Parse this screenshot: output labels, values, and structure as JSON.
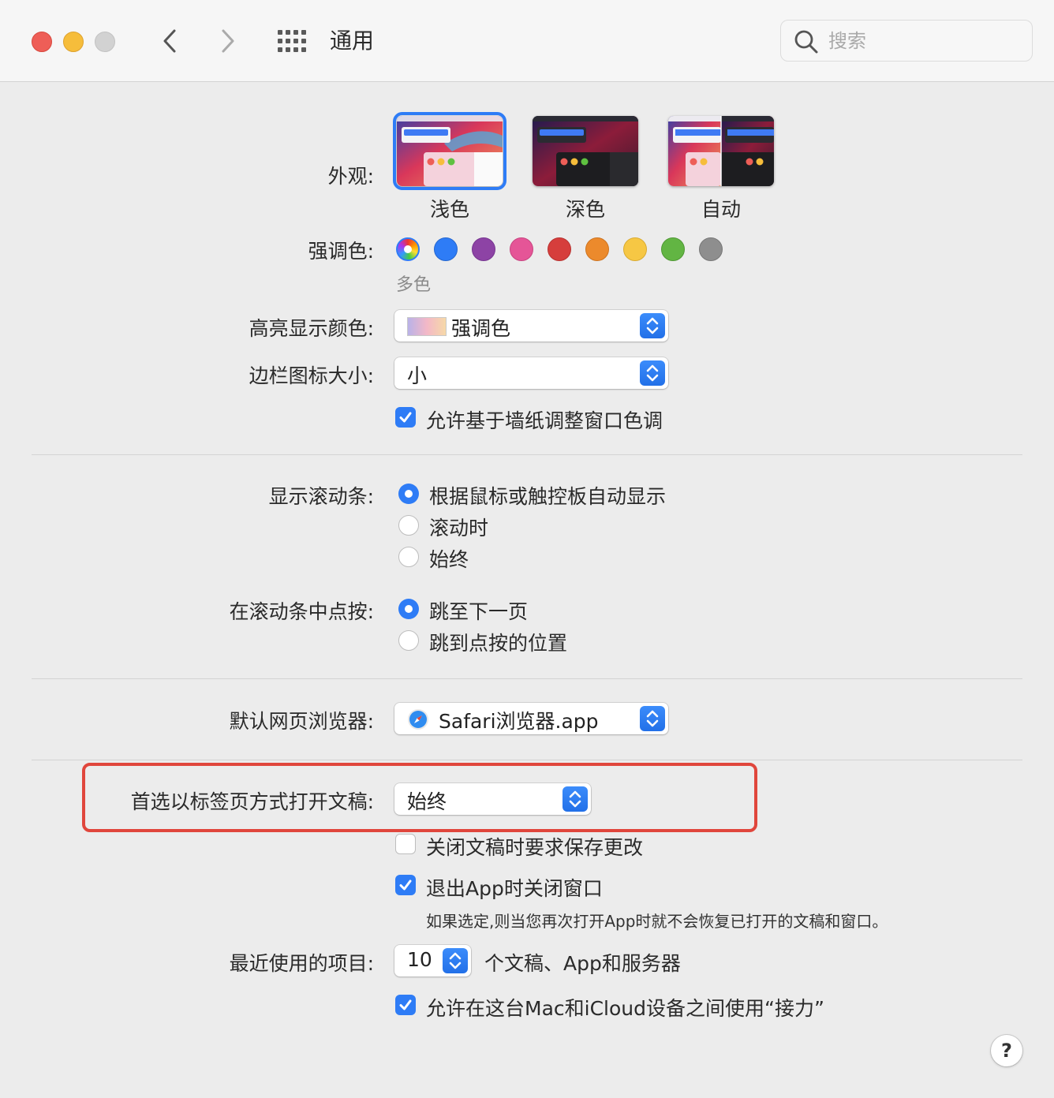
{
  "window": {
    "title": "通用",
    "search_placeholder": "搜索"
  },
  "appearance": {
    "label": "外观:",
    "options": [
      {
        "label": "浅色",
        "selected": true
      },
      {
        "label": "深色",
        "selected": false
      },
      {
        "label": "自动",
        "selected": false
      }
    ]
  },
  "accent": {
    "label": "强调色:",
    "selected_caption": "多色",
    "colors": [
      "multicolor",
      "#2e7cf6",
      "#8d43a5",
      "#e55597",
      "#d63e3c",
      "#ec8a2c",
      "#f6c744",
      "#62b543",
      "#8e8e8e"
    ]
  },
  "highlight": {
    "label": "高亮显示颜色:",
    "value": "强调色"
  },
  "sidebar_icon_size": {
    "label": "边栏图标大小:",
    "value": "小"
  },
  "wallpaper_tint": {
    "label": "允许基于墙纸调整窗口色调",
    "checked": true
  },
  "show_scrollbars": {
    "label": "显示滚动条:",
    "options": [
      {
        "label": "根据鼠标或触控板自动显示",
        "selected": true
      },
      {
        "label": "滚动时",
        "selected": false
      },
      {
        "label": "始终",
        "selected": false
      }
    ]
  },
  "click_scrollbar": {
    "label": "在滚动条中点按:",
    "options": [
      {
        "label": "跳至下一页",
        "selected": true
      },
      {
        "label": "跳到点按的位置",
        "selected": false
      }
    ]
  },
  "default_browser": {
    "label": "默认网页浏览器:",
    "value": "Safari浏览器.app"
  },
  "prefer_tabs": {
    "label": "首选以标签页方式打开文稿:",
    "value": "始终"
  },
  "ask_keep_changes": {
    "label": "关闭文稿时要求保存更改",
    "checked": false
  },
  "close_windows": {
    "label": "退出App时关闭窗口",
    "checked": true,
    "description": "如果选定,则当您再次打开App时就不会恢复已打开的文稿和窗口。"
  },
  "recent_items": {
    "label": "最近使用的项目:",
    "value": "10",
    "suffix": "个文稿、App和服务器"
  },
  "handoff": {
    "label": "允许在这台Mac和iCloud设备之间使用“接力”",
    "checked": true
  },
  "help": {
    "label": "?"
  }
}
